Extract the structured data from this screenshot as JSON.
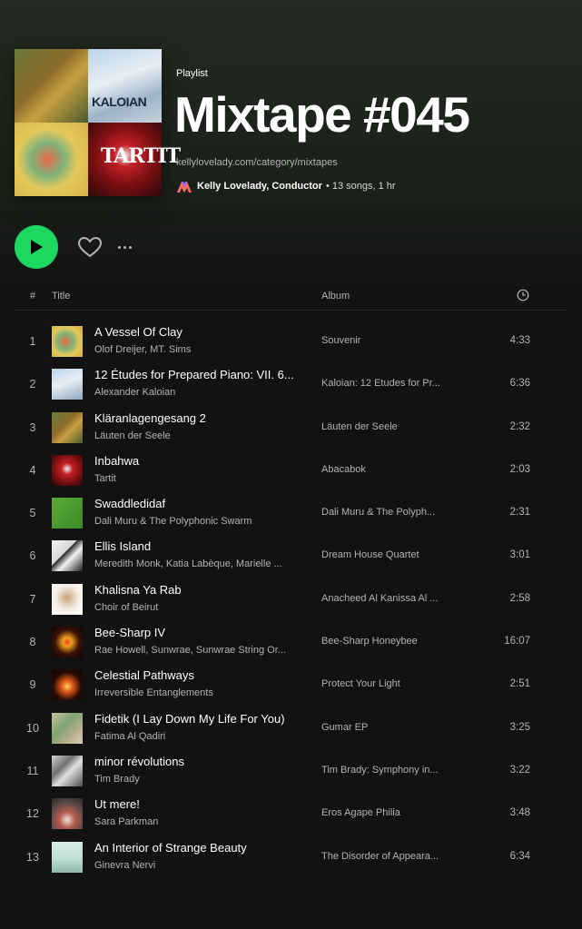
{
  "playlist": {
    "type": "Playlist",
    "title": "Mixtape #045",
    "description": "kellylovelady.com/category/mixtapes",
    "owner": "Kelly Lovelady, Conductor",
    "stats": "• 13 songs, 1 hr",
    "cover_texts": {
      "top_right": "KALOIAN",
      "bottom_right": "TARTIT"
    }
  },
  "colors": {
    "accent": "#1ed760",
    "background": "#121212",
    "secondary_text": "#b3b3b3"
  },
  "table": {
    "header": {
      "num": "#",
      "title": "Title",
      "album": "Album"
    },
    "rows": [
      {
        "num": "1",
        "title": "A Vessel Of Clay",
        "artist": "Olof Dreijer, MT. Sims",
        "album": "Souvenir",
        "duration": "4:33"
      },
      {
        "num": "2",
        "title": "12 Études for Prepared Piano: VII. 6...",
        "artist": "Alexander Kaloian",
        "album": "Kaloian: 12 Etudes for Pr...",
        "duration": "6:36"
      },
      {
        "num": "3",
        "title": "Kläranlagengesang 2",
        "artist": "Läuten der Seele",
        "album": "Läuten der Seele",
        "duration": "2:32"
      },
      {
        "num": "4",
        "title": "Inbahwa",
        "artist": "Tartit",
        "album": "Abacabok",
        "duration": "2:03"
      },
      {
        "num": "5",
        "title": "Swaddledidaf",
        "artist": "Dali Muru & The Polyphonic Swarm",
        "album": "Dali Muru & The Polyph...",
        "duration": "2:31"
      },
      {
        "num": "6",
        "title": "Ellis Island",
        "artist": "Meredith Monk, Katia Labèque, Marielle ...",
        "album": "Dream House Quartet",
        "duration": "3:01"
      },
      {
        "num": "7",
        "title": "Khalisna Ya Rab",
        "artist": "Choir of Beirut",
        "album": "Anacheed Al Kanissa Al ...",
        "duration": "2:58"
      },
      {
        "num": "8",
        "title": "Bee-Sharp IV",
        "artist": "Rae Howell, Sunwrae, Sunwrae String Or...",
        "album": "Bee-Sharp Honeybee",
        "duration": "16:07"
      },
      {
        "num": "9",
        "title": "Celestial Pathways",
        "artist": "Irreversible Entanglements",
        "album": "Protect Your Light",
        "duration": "2:51"
      },
      {
        "num": "10",
        "title": "Fidetik (I Lay Down My Life For You)",
        "artist": "Fatima Al Qadiri",
        "album": "Gumar EP",
        "duration": "3:25"
      },
      {
        "num": "11",
        "title": "minor révolutions",
        "artist": "Tim Brady",
        "album": "Tim Brady: Symphony in...",
        "duration": "3:22"
      },
      {
        "num": "12",
        "title": "Ut mere!",
        "artist": "Sara Parkman",
        "album": "Eros Agape Philia",
        "duration": "3:48"
      },
      {
        "num": "13",
        "title": "An Interior of Strange Beauty",
        "artist": "Ginevra Nervi",
        "album": "The Disorder of Appeara...",
        "duration": "6:34"
      }
    ]
  },
  "icons": [
    "play-icon",
    "heart-icon",
    "more-icon",
    "clock-icon",
    "owner-logo-icon"
  ]
}
